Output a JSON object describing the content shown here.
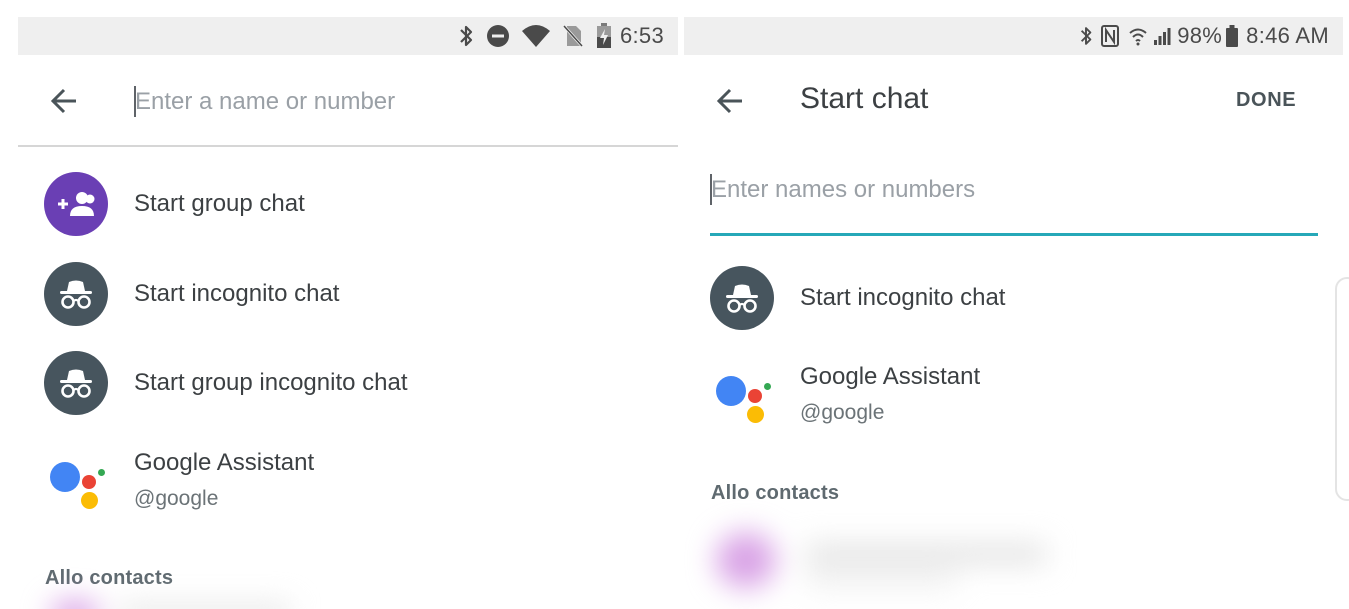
{
  "left": {
    "status": {
      "time": "6:53",
      "icons": [
        "bluetooth-icon",
        "do-not-disturb-icon",
        "wifi-icon",
        "no-sim-icon",
        "battery-charging-icon"
      ]
    },
    "search": {
      "placeholder": "Enter a name or number",
      "value": ""
    },
    "items": [
      {
        "label": "Start group chat",
        "icon": "group-add-icon",
        "color": "#6a3fb4"
      },
      {
        "label": "Start incognito chat",
        "icon": "incognito-icon",
        "color": "#47555e"
      },
      {
        "label": "Start group incognito chat",
        "icon": "incognito-icon",
        "color": "#47555e"
      },
      {
        "label": "Google Assistant",
        "sub": "@google",
        "icon": "google-assistant-icon"
      }
    ],
    "section_header": "Allo contacts"
  },
  "right": {
    "status": {
      "time": "8:46 AM",
      "battery": "98%",
      "icons": [
        "bluetooth-icon",
        "nfc-icon",
        "wifi-icon",
        "signal-icon",
        "battery-icon"
      ]
    },
    "title": "Start chat",
    "done_label": "DONE",
    "search": {
      "placeholder": "Enter names or numbers",
      "value": ""
    },
    "items": [
      {
        "label": "Start incognito chat",
        "icon": "incognito-icon",
        "color": "#47555e"
      },
      {
        "label": "Google Assistant",
        "sub": "@google",
        "icon": "google-assistant-icon"
      }
    ],
    "section_header": "Allo contacts"
  },
  "colors": {
    "accent_underline": "#26a8b8",
    "group_avatar": "#6a3fb4",
    "incognito_avatar": "#47555e",
    "ga_blue": "#4285f4",
    "ga_red": "#ea4335",
    "ga_yellow": "#fbbc05",
    "ga_green": "#34a853"
  }
}
